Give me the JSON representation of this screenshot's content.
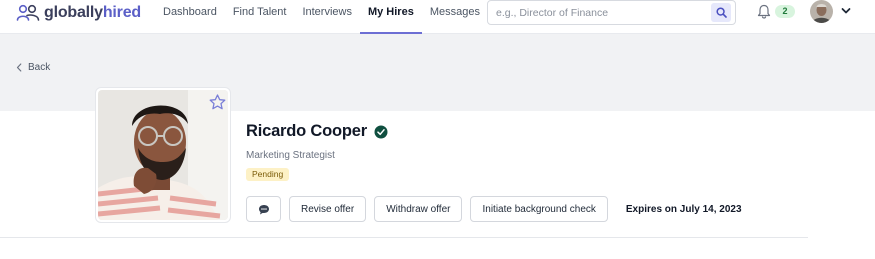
{
  "brand": {
    "name_part1": "globally",
    "name_part2": "hired"
  },
  "nav": {
    "items": [
      {
        "label": "Dashboard"
      },
      {
        "label": "Find Talent"
      },
      {
        "label": "Interviews"
      },
      {
        "label": "My Hires"
      },
      {
        "label": "Messages"
      }
    ],
    "active": "My Hires"
  },
  "search": {
    "placeholder": "e.g., Director of Finance",
    "value": ""
  },
  "notifications": {
    "count": "2"
  },
  "icons": {
    "logo": "people-logo-icon",
    "search": "search-icon",
    "bell": "bell-icon",
    "menu": "chevron-down-icon",
    "back": "chevron-left-icon",
    "favorite": "star-icon",
    "verified": "verified-badge-icon",
    "message": "chat-bubble-icon"
  },
  "back": {
    "label": "Back"
  },
  "candidate": {
    "name": "Ricardo Cooper",
    "title": "Marketing Strategist",
    "status": "Pending",
    "verified": true
  },
  "actions": {
    "revise": "Revise offer",
    "withdraw": "Withdraw offer",
    "background_check": "Initiate background check"
  },
  "offer": {
    "expires_text": "Expires on July 14, 2023"
  },
  "colors": {
    "accent": "#6d6fd4",
    "brand_dark": "#3b3f5c",
    "brand_light": "#5b5fc7",
    "band": "#f1f2f4",
    "pending_bg": "#fdf1c6",
    "badge_bg": "#d8f4de",
    "verified": "#0f4f3f"
  }
}
